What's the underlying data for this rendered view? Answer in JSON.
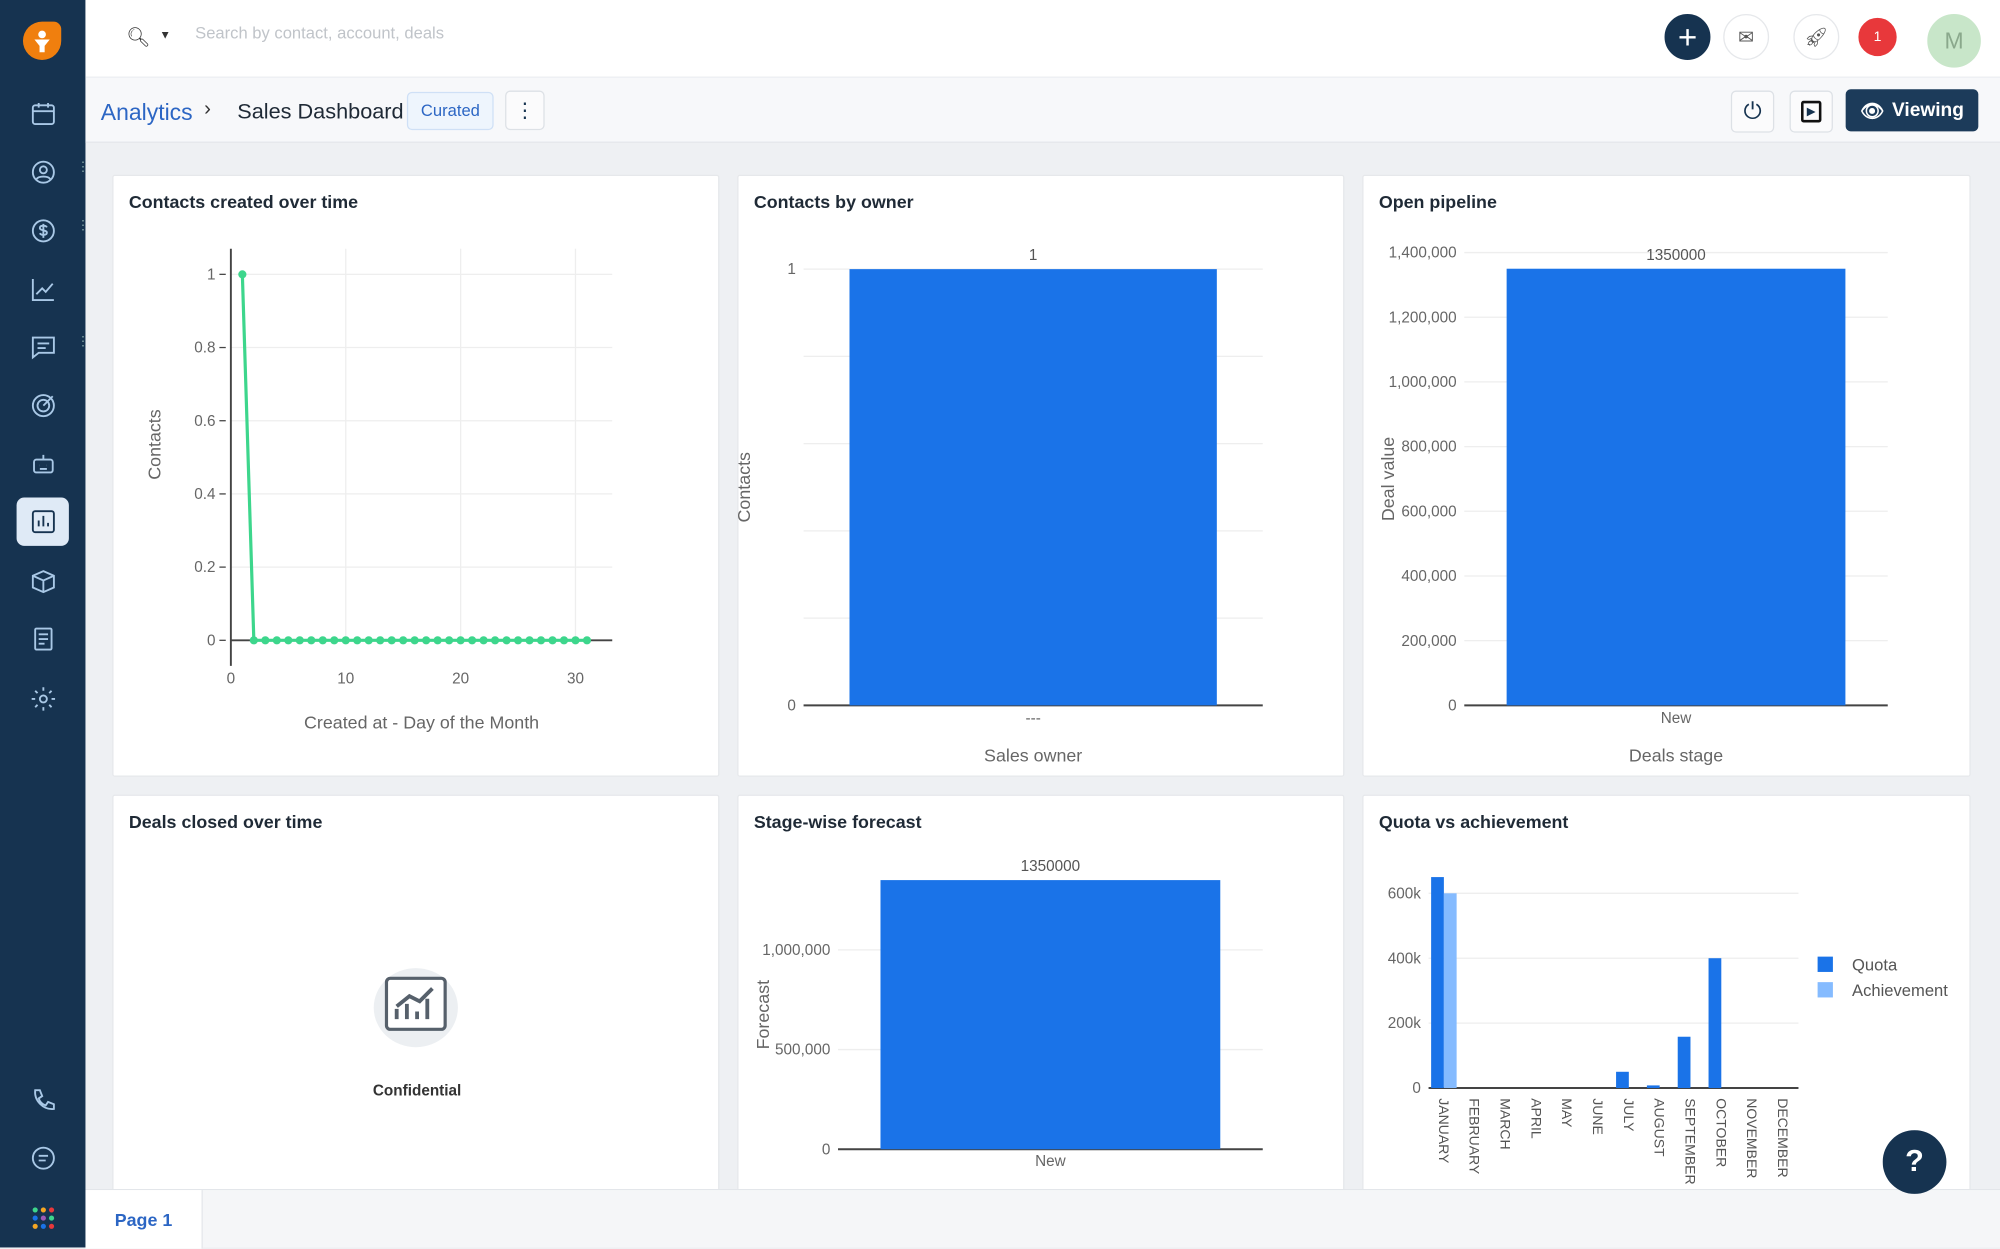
{
  "search": {
    "placeholder": "Search by contact, account, deals"
  },
  "header": {
    "notification_count": "1",
    "avatar_initial": "M"
  },
  "breadcrumb": {
    "parent": "Analytics",
    "current": "Sales Dashboard",
    "badge": "Curated"
  },
  "toolbar": {
    "viewing_label": "Viewing"
  },
  "pages": {
    "tabs": [
      {
        "label": "Page 1"
      }
    ]
  },
  "confidential_label": "Confidential",
  "help_label": "?",
  "colors": {
    "sidebar": "#163350",
    "accent": "#1a73e8",
    "bar": "#1a73e8",
    "achievement": "#85bbff",
    "line": "#3dd68c",
    "badge": "#e8383b"
  },
  "chart_data": [
    {
      "type": "line",
      "title": "Contacts created over time",
      "xlabel": "Created at - Day of the Month",
      "ylabel": "Contacts",
      "x": [
        1,
        2,
        3,
        4,
        5,
        6,
        7,
        8,
        9,
        10,
        11,
        12,
        13,
        14,
        15,
        16,
        17,
        18,
        19,
        20,
        21,
        22,
        23,
        24,
        25,
        26,
        27,
        28,
        29,
        30,
        31
      ],
      "y": [
        1,
        0,
        0,
        0,
        0,
        0,
        0,
        0,
        0,
        0,
        0,
        0,
        0,
        0,
        0,
        0,
        0,
        0,
        0,
        0,
        0,
        0,
        0,
        0,
        0,
        0,
        0,
        0,
        0,
        0,
        0
      ],
      "xlim": [
        0,
        33.2
      ],
      "ylim": [
        0,
        1.07
      ],
      "xticks": [
        0,
        10,
        20,
        30
      ],
      "xtick_labels": [
        "0",
        "10",
        "20",
        "30"
      ],
      "yticks": [
        0,
        0.2,
        0.4,
        0.6,
        0.8,
        1
      ],
      "ytick_labels": [
        "0",
        "0.2",
        "0.4",
        "0.6",
        "0.8",
        "1"
      ],
      "grid": true
    },
    {
      "type": "bar",
      "title": "Contacts by owner",
      "xlabel": "Sales owner",
      "ylabel": "Contacts",
      "categories": [
        "---"
      ],
      "values": [
        1
      ],
      "data_labels": [
        "1"
      ],
      "ylim": [
        0,
        1
      ],
      "yticks": [
        0,
        1
      ],
      "ytick_labels": [
        "0",
        "1"
      ],
      "grid": true
    },
    {
      "type": "bar",
      "title": "Open pipeline",
      "xlabel": "Deals stage",
      "ylabel": "Deal value",
      "categories": [
        "New"
      ],
      "values": [
        1350000
      ],
      "data_labels": [
        "1350000"
      ],
      "ylim": [
        0,
        1400000
      ],
      "yticks": [
        0,
        200000,
        400000,
        600000,
        800000,
        1000000,
        1200000,
        1400000
      ],
      "ytick_labels": [
        "0",
        "200,000",
        "400,000",
        "600,000",
        "800,000",
        "1,000,000",
        "1,200,000",
        "1,400,000"
      ],
      "grid": true
    },
    {
      "type": "bar",
      "title": "Stage-wise forecast",
      "xlabel": "",
      "ylabel": "Forecast",
      "categories": [
        "New"
      ],
      "values": [
        1350000
      ],
      "data_labels": [
        "1350000"
      ],
      "ylim": [
        0,
        1350000
      ],
      "yticks": [
        0,
        500000,
        1000000
      ],
      "ytick_labels": [
        "0",
        "500,000",
        "1,000,000"
      ],
      "grid": true
    },
    {
      "type": "bar",
      "title": "Quota vs achievement",
      "xlabel": "",
      "ylabel": "",
      "categories": [
        "JANUARY",
        "FEBRUARY",
        "MARCH",
        "APRIL",
        "MAY",
        "JUNE",
        "JULY",
        "AUGUST",
        "SEPTEMBER",
        "OCTOBER",
        "NOVEMBER",
        "DECEMBER"
      ],
      "series": [
        {
          "name": "Quota",
          "values": [
            650000,
            0,
            0,
            0,
            0,
            0,
            50000,
            8000,
            158000,
            400000,
            0,
            0
          ]
        },
        {
          "name": "Achievement",
          "values": [
            600000,
            0,
            0,
            0,
            0,
            0,
            0,
            0,
            0,
            0,
            0,
            0
          ]
        }
      ],
      "ylim": [
        0,
        680000
      ],
      "yticks": [
        0,
        200000,
        400000,
        600000
      ],
      "ytick_labels": [
        "0",
        "200k",
        "400k",
        "600k"
      ],
      "grid": true,
      "legend": "right"
    },
    {
      "type": "none",
      "title": "Deals closed over time"
    }
  ]
}
